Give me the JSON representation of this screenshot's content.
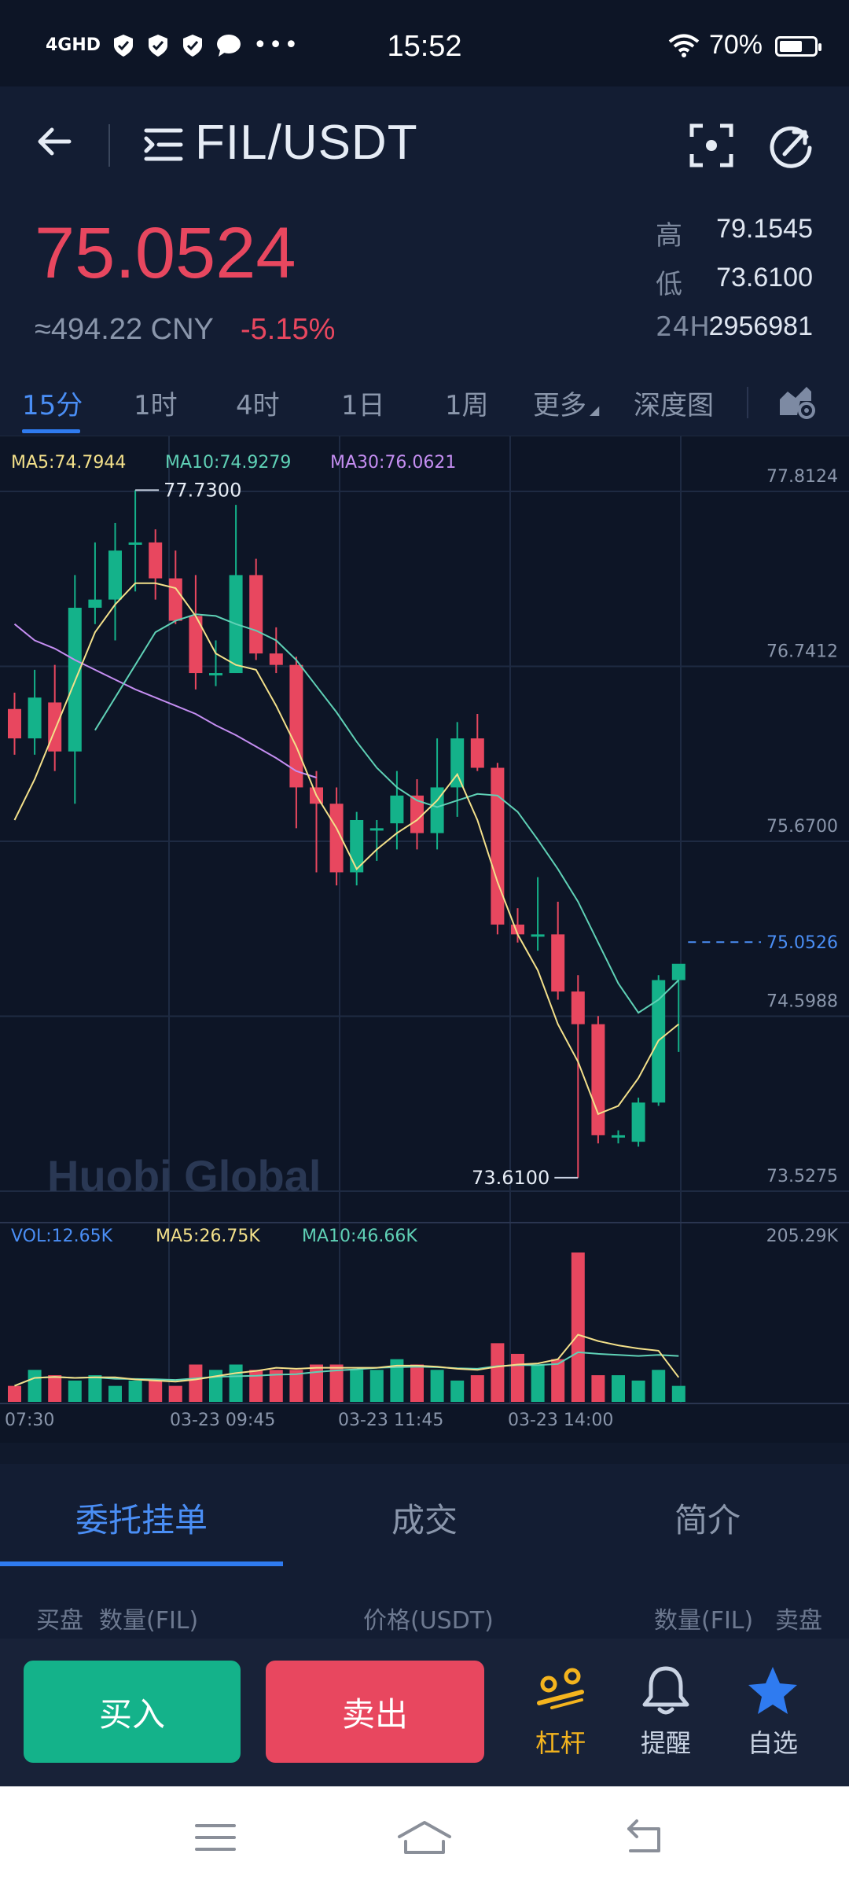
{
  "status": {
    "network": "4GHD",
    "time": "15:52",
    "battery": "70%",
    "battery_level": 0.7
  },
  "header": {
    "pair": "FIL/USDT"
  },
  "ticker": {
    "last": "75.0524",
    "cny": "≈494.22 CNY",
    "change": "-5.15%",
    "high_label": "高",
    "high": "79.1545",
    "low_label": "低",
    "low": "73.6100",
    "vol_label": "24H",
    "vol": "2956981"
  },
  "tabs": [
    "15分",
    "1时",
    "4时",
    "1日",
    "1周",
    "更多",
    "深度图"
  ],
  "indicators": {
    "ma5": "MA5:74.7944",
    "ma10": "MA10:74.9279",
    "ma30": "MA30:76.0621",
    "vol": "VOL:12.65K",
    "vma5": "MA5:26.75K",
    "vma10": "MA10:46.66K"
  },
  "watermark": "Huobi Global",
  "colors": {
    "up": "#14b28a",
    "down": "#e8475f",
    "accent": "#2f7bf0",
    "ma5": "#f3e08a",
    "ma10": "#5fd1b6",
    "ma30": "#c58ef2",
    "leverage": "#f4b41e"
  },
  "chart_data": {
    "type": "candlestick",
    "y_ticks": [
      "77.8124",
      "76.7412",
      "75.6700",
      "74.5988",
      "73.5275"
    ],
    "ylim": [
      73.5275,
      77.8124
    ],
    "x_ticks": [
      "07:30",
      "03-23 09:45",
      "03-23 11:45",
      "03-23 14:00"
    ],
    "current_price": "75.0526",
    "max_label": "77.7300",
    "min_label": "73.6100",
    "volume_max": "205.29K",
    "candles": [
      [
        76.48,
        76.3,
        76.58,
        76.2
      ],
      [
        76.3,
        76.55,
        76.72,
        76.2
      ],
      [
        76.52,
        76.22,
        76.75,
        76.1
      ],
      [
        76.22,
        77.1,
        77.3,
        75.9
      ],
      [
        77.1,
        77.15,
        77.5,
        77.0
      ],
      [
        77.15,
        77.45,
        77.62,
        76.9
      ],
      [
        77.5,
        77.5,
        77.82,
        77.2
      ],
      [
        77.5,
        77.28,
        77.58,
        77.15
      ],
      [
        77.28,
        77.02,
        77.45,
        77.0
      ],
      [
        77.05,
        76.7,
        77.3,
        76.6
      ],
      [
        76.7,
        76.7,
        76.9,
        76.62
      ],
      [
        76.7,
        77.3,
        77.73,
        76.7
      ],
      [
        77.3,
        76.82,
        77.4,
        76.78
      ],
      [
        76.82,
        76.75,
        76.98,
        76.7
      ],
      [
        76.75,
        76.0,
        76.8,
        75.75
      ],
      [
        76.0,
        75.9,
        76.1,
        75.48
      ],
      [
        75.9,
        75.48,
        76.0,
        75.4
      ],
      [
        75.48,
        75.8,
        75.85,
        75.4
      ],
      [
        75.75,
        75.75,
        75.8,
        75.55
      ],
      [
        75.78,
        75.95,
        76.1,
        75.62
      ],
      [
        75.95,
        75.72,
        76.05,
        75.62
      ],
      [
        75.72,
        76.0,
        76.3,
        75.62
      ],
      [
        76.0,
        76.3,
        76.4,
        75.82
      ],
      [
        76.3,
        76.12,
        76.45,
        76.1
      ],
      [
        76.12,
        75.16,
        76.15,
        75.1
      ],
      [
        75.16,
        75.1,
        75.26,
        75.05
      ],
      [
        75.1,
        75.1,
        75.45,
        75.0
      ],
      [
        75.1,
        74.75,
        75.3,
        74.7
      ],
      [
        74.75,
        74.55,
        74.85,
        73.61
      ],
      [
        74.55,
        73.87,
        74.6,
        73.82
      ],
      [
        73.87,
        73.87,
        73.9,
        73.82
      ],
      [
        73.83,
        74.07,
        74.1,
        73.8
      ],
      [
        74.07,
        74.82,
        74.85,
        74.05
      ],
      [
        74.82,
        74.92,
        74.9,
        74.38
      ]
    ],
    "ma5": [
      75.8,
      76.05,
      76.35,
      76.65,
      76.95,
      77.12,
      77.25,
      77.25,
      77.22,
      77.05,
      76.82,
      76.75,
      76.72,
      76.5,
      76.25,
      75.95,
      75.75,
      75.5,
      75.62,
      75.72,
      75.8,
      75.92,
      76.08,
      75.8,
      75.42,
      75.1,
      74.88,
      74.55,
      74.32,
      74.0,
      74.05,
      74.22,
      74.45,
      74.55
    ],
    "ma10": [
      76.35,
      76.55,
      76.75,
      76.95,
      77.02,
      77.06,
      77.05,
      77.0,
      76.96,
      76.9,
      76.78,
      76.62,
      76.46,
      76.28,
      76.12,
      76.0,
      75.92,
      75.88,
      75.92,
      75.96,
      75.95,
      75.85,
      75.68,
      75.5,
      75.3,
      75.05,
      74.8,
      74.62,
      74.7,
      74.82
    ],
    "ma30": [
      77.0,
      76.9,
      76.85,
      76.78,
      76.72,
      76.66,
      76.6,
      76.55,
      76.5,
      76.45,
      76.38,
      76.32,
      76.25,
      76.18,
      76.1,
      76.06
    ],
    "volume": [
      3,
      6,
      5,
      4,
      5,
      3,
      4,
      4,
      3,
      7,
      6,
      7,
      6,
      6,
      6,
      7,
      7,
      6,
      6,
      8,
      7,
      6,
      4,
      5,
      11,
      9,
      7,
      8,
      28,
      5,
      5,
      4,
      6,
      3
    ]
  },
  "sheet_tabs": [
    "委托挂单",
    "成交",
    "简介"
  ],
  "orderbook_headers": [
    "买盘",
    "数量(FIL)",
    "价格(USDT)",
    "数量(FIL)",
    "卖盘"
  ],
  "actions": {
    "buy": "买入",
    "sell": "卖出",
    "leverage": "杠杆",
    "alert": "提醒",
    "favorite": "自选"
  }
}
